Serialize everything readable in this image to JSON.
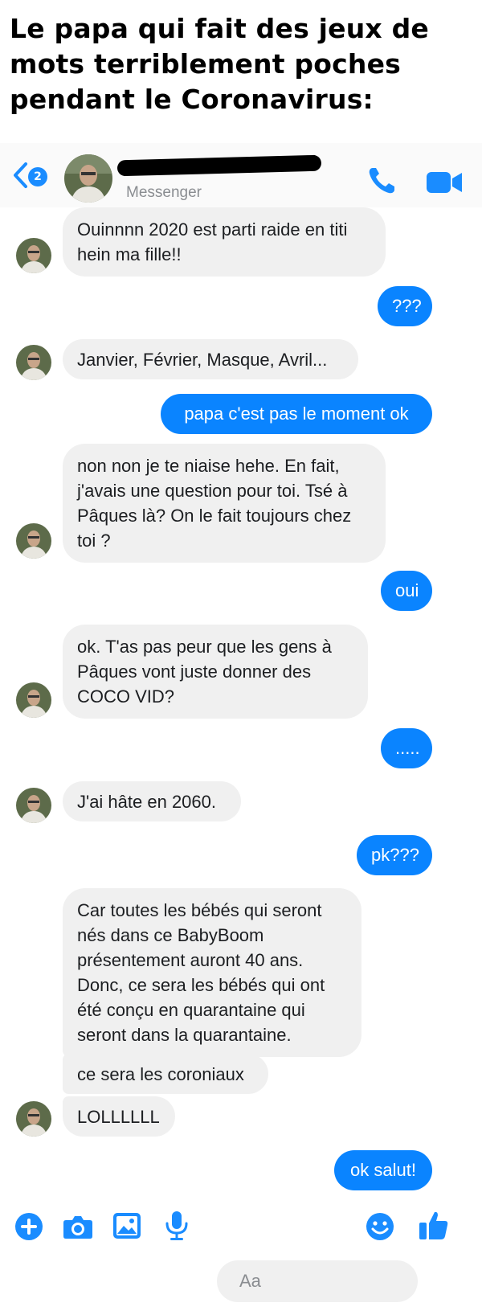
{
  "meme": {
    "title": "Le papa qui fait des jeux de mots terriblement poches pendant le Coronavirus:"
  },
  "header": {
    "back_icon": "chevron-left-icon",
    "unread_badge": "2",
    "subtitle": "Messenger",
    "call_icon": "phone-icon",
    "video_icon": "video-camera-icon"
  },
  "messages": [
    {
      "from": "dad",
      "text": "Ouinnnn 2020 est parti raide en titi\nhein ma fille!!"
    },
    {
      "from": "me",
      "text": "???"
    },
    {
      "from": "dad",
      "text": "Janvier, Février, Masque, Avril..."
    },
    {
      "from": "me",
      "text": "papa c'est pas le moment ok"
    },
    {
      "from": "dad",
      "text": "non non je te niaise hehe. En fait,\nj'avais une question pour toi. Tsé à\nPâques là? On le fait toujours chez\ntoi ?"
    },
    {
      "from": "me",
      "text": "oui"
    },
    {
      "from": "dad",
      "text": "ok. T'as pas peur que les gens à\nPâques vont juste donner des\nCOCO VID?"
    },
    {
      "from": "me",
      "text": "....."
    },
    {
      "from": "dad",
      "text": "J'ai hâte en 2060."
    },
    {
      "from": "me",
      "text": "pk???"
    },
    {
      "from": "dad",
      "text": "Car toutes les bébés qui seront\nnés dans ce BabyBoom\nprésentement auront 40 ans.\nDonc, ce sera les bébés qui ont\nété conçu en quarantaine qui\nseront dans la quarantaine."
    },
    {
      "from": "dad",
      "text": "ce sera les coroniaux"
    },
    {
      "from": "dad",
      "text": "LOLLLLLL"
    },
    {
      "from": "me",
      "text": "ok salut!"
    }
  ],
  "composer": {
    "placeholder": "Aa",
    "icons": [
      "plus-icon",
      "camera-icon",
      "image-icon",
      "microphone-icon",
      "emoji-icon",
      "thumbs-up-icon"
    ]
  },
  "colors": {
    "accent": "#0a84ff",
    "incoming_bubble": "#f0f0f0",
    "outgoing_text": "#ffffff"
  }
}
